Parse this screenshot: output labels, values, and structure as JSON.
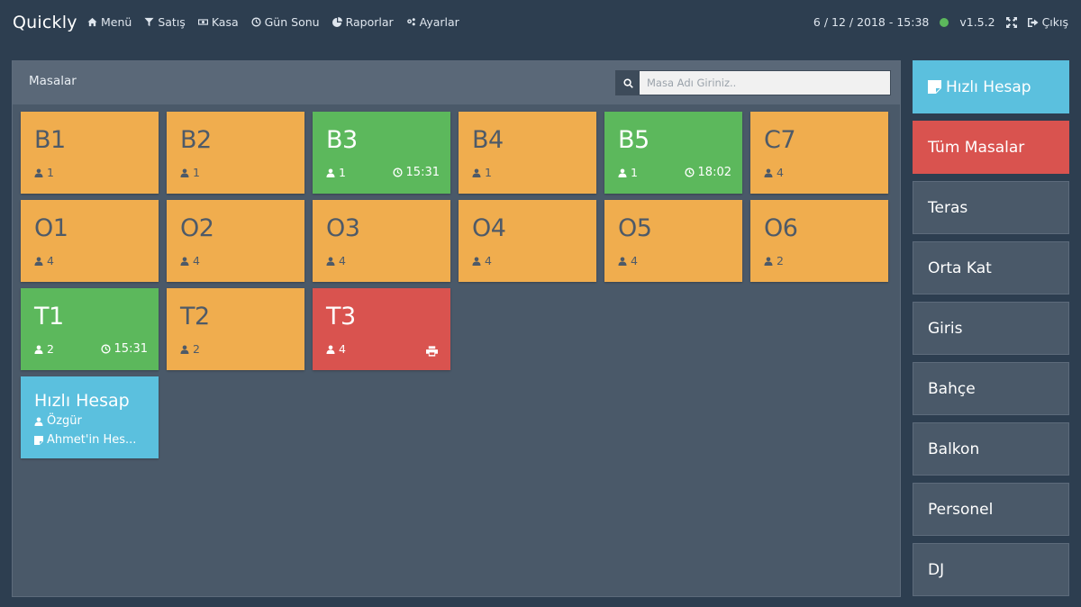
{
  "app": {
    "brand": "Quickly"
  },
  "nav": [
    {
      "label": "Menü",
      "icon": "home-icon"
    },
    {
      "label": "Satış",
      "icon": "filter-icon"
    },
    {
      "label": "Kasa",
      "icon": "money-icon"
    },
    {
      "label": "Gün Sonu",
      "icon": "clock-icon"
    },
    {
      "label": "Raporlar",
      "icon": "pie-chart-icon"
    },
    {
      "label": "Ayarlar",
      "icon": "gears-icon"
    }
  ],
  "status": {
    "datetime": "6 / 12 / 2018 - 15:38",
    "online_color": "#5cb85c",
    "version": "v1.5.2",
    "logout_label": "Çıkış"
  },
  "panel": {
    "title": "Masalar",
    "search_placeholder": "Masa Adı Giriniz.."
  },
  "colors": {
    "free": "#f0ad4e",
    "occupied": "#5cb85c",
    "printed": "#d9534f",
    "quick": "#5bc0de"
  },
  "tables": [
    {
      "name": "B1",
      "guests": "1",
      "time": "",
      "state": "free"
    },
    {
      "name": "B2",
      "guests": "1",
      "time": "",
      "state": "free"
    },
    {
      "name": "B3",
      "guests": "1",
      "time": "15:31",
      "state": "occupied"
    },
    {
      "name": "B4",
      "guests": "1",
      "time": "",
      "state": "free"
    },
    {
      "name": "B5",
      "guests": "1",
      "time": "18:02",
      "state": "occupied"
    },
    {
      "name": "C7",
      "guests": "4",
      "time": "",
      "state": "free"
    },
    {
      "name": "O1",
      "guests": "4",
      "time": "",
      "state": "free"
    },
    {
      "name": "O2",
      "guests": "4",
      "time": "",
      "state": "free"
    },
    {
      "name": "O3",
      "guests": "4",
      "time": "",
      "state": "free"
    },
    {
      "name": "O4",
      "guests": "4",
      "time": "",
      "state": "free"
    },
    {
      "name": "O5",
      "guests": "4",
      "time": "",
      "state": "free"
    },
    {
      "name": "O6",
      "guests": "2",
      "time": "",
      "state": "free"
    },
    {
      "name": "T1",
      "guests": "2",
      "time": "15:31",
      "state": "occupied"
    },
    {
      "name": "T2",
      "guests": "2",
      "time": "",
      "state": "free"
    },
    {
      "name": "T3",
      "guests": "4",
      "time": "",
      "state": "printed"
    }
  ],
  "quick_tile": {
    "name": "Hızlı Hesap",
    "user": "Özgür",
    "note": "Ahmet'in Hes..."
  },
  "sidebar": [
    {
      "label": "Hızlı Hesap",
      "style": "blue",
      "icon": "note-icon"
    },
    {
      "label": "Tüm Masalar",
      "style": "red"
    },
    {
      "label": "Teras"
    },
    {
      "label": "Orta Kat"
    },
    {
      "label": "Giris"
    },
    {
      "label": "Bahçe"
    },
    {
      "label": "Balkon"
    },
    {
      "label": "Personel"
    },
    {
      "label": "DJ"
    }
  ]
}
